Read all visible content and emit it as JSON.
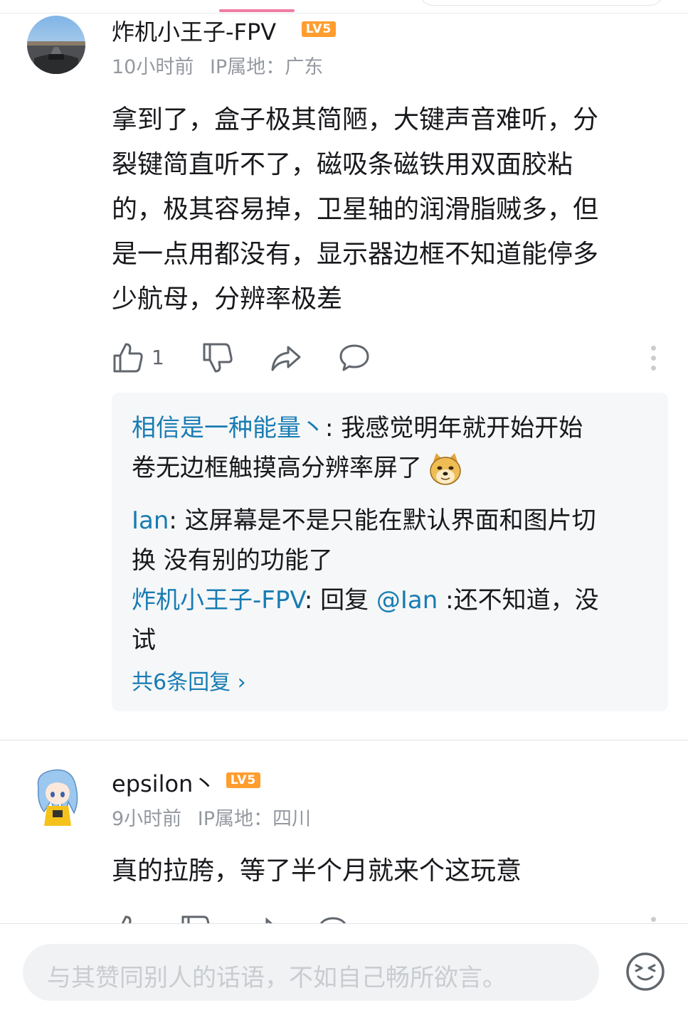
{
  "comments": [
    {
      "username": "炸机小王子-FPV",
      "level": "LV5",
      "time": "10小时前",
      "ip": "IP属地：广东",
      "text": [
        "拿到了，盒子极其简陋，大键声音难听，分",
        "裂键简直听不了，磁吸条磁铁用双面胶粘",
        "的，极其容易掉，卫星轴的润滑脂贼多，但",
        "是一点用都没有，显示器边框不知道能停多",
        "少航母，分辨率极差"
      ],
      "likes": "1"
    },
    {
      "username": "epsilon丶",
      "level": "LV5",
      "time": "9小时前",
      "ip": "IP属地：四川",
      "text": "真的拉胯，等了半个月就来个这玩意"
    }
  ],
  "replies": [
    {
      "name": "相信是一种能量丶",
      "sep": ": ",
      "line1": "我感觉明年就开始开始",
      "line2": "卷无边框触摸高分辨率屏了"
    },
    {
      "name": "Ian",
      "sep": ": ",
      "line1": "这屏幕是不是只能在默认界面和图片切",
      "line2": "换 没有别的功能了"
    },
    {
      "name": "炸机小王子-FPV",
      "sep": ": ",
      "pre": "回复 ",
      "at": "@Ian",
      "line1": " :还不知道，没",
      "line2": "试"
    }
  ],
  "more_replies": "共6条回复 ›",
  "input_placeholder": "与其赞同别人的话语，不如自己畅所欲言。",
  "colors": {
    "accent": "#f07ca2",
    "link": "#187cb3",
    "level": "#ff9d2e"
  }
}
